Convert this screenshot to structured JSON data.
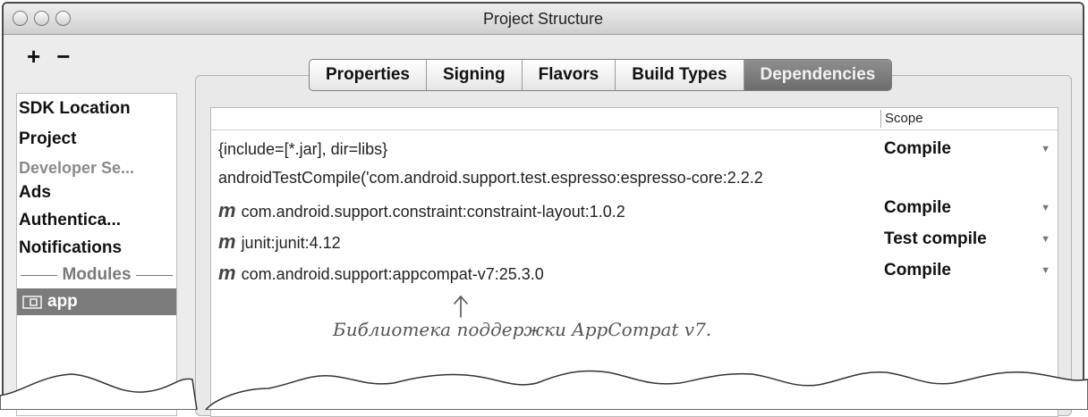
{
  "window": {
    "title": "Project Structure"
  },
  "toolbar": {
    "add_label": "+",
    "remove_label": "−"
  },
  "sidebar": {
    "items": [
      {
        "label": "SDK Location"
      },
      {
        "label": "Project"
      },
      {
        "label": "Developer Se..."
      },
      {
        "label": "Ads"
      },
      {
        "label": "Authentica..."
      },
      {
        "label": "Notifications"
      }
    ],
    "modules_header": "Modules",
    "app_label": "app"
  },
  "tabs": [
    "Properties",
    "Signing",
    "Flavors",
    "Build Types",
    "Dependencies"
  ],
  "table": {
    "scope_header": "Scope",
    "rows": [
      {
        "m": "",
        "text": "{include=[*.jar], dir=libs}",
        "scope": "Compile"
      },
      {
        "m": "",
        "text": "androidTestCompile('com.android.support.test.espresso:espresso-core:2.2.2",
        "scope": ""
      },
      {
        "m": "m",
        "text": "com.android.support.constraint:constraint-layout:1.0.2",
        "scope": "Compile"
      },
      {
        "m": "m",
        "text": "junit:junit:4.12",
        "scope": "Test compile"
      },
      {
        "m": "m",
        "text": "com.android.support:appcompat-v7:25.3.0",
        "scope": "Compile"
      }
    ]
  },
  "annotation": {
    "text": "Библиотека поддержки AppCompat v7."
  },
  "colors": {
    "active_tab": "#7a7a7a",
    "selected_row": "#7b7b7b",
    "window_bg": "#ececec"
  }
}
